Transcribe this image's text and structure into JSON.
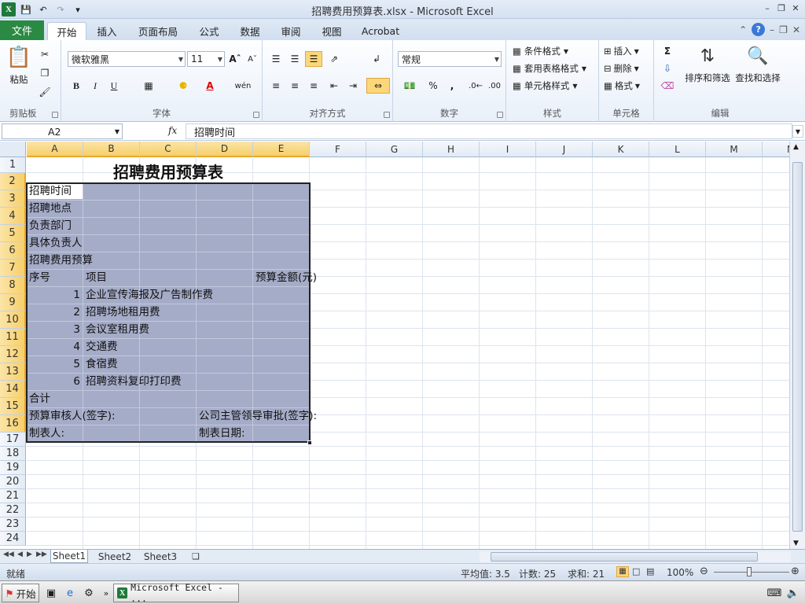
{
  "window": {
    "title": "招聘费用预算表.xlsx - Microsoft Excel"
  },
  "ribbon_tabs": [
    {
      "label": "文件"
    },
    {
      "label": "开始"
    },
    {
      "label": "插入"
    },
    {
      "label": "页面布局"
    },
    {
      "label": "公式"
    },
    {
      "label": "数据"
    },
    {
      "label": "审阅"
    },
    {
      "label": "视图"
    },
    {
      "label": "Acrobat"
    }
  ],
  "ribbon": {
    "clipboard": {
      "paste": "粘贴",
      "group": "剪贴板"
    },
    "font": {
      "name": "微软雅黑",
      "size": "11",
      "group": "字体",
      "bold": "B",
      "italic": "I",
      "underline": "U",
      "wen": "wén"
    },
    "alignment": {
      "group": "对齐方式"
    },
    "number": {
      "format": "常规",
      "group": "数字",
      "percent": "%",
      "comma": ","
    },
    "styles": {
      "conditional": "条件格式",
      "table": "套用表格格式",
      "cell": "单元格样式",
      "group": "样式"
    },
    "cells": {
      "insert": "插入",
      "delete": "删除",
      "format": "格式",
      "group": "单元格"
    },
    "editing": {
      "sort": "排序和筛选",
      "find": "查找和选择",
      "group": "编辑",
      "sum": "Σ"
    }
  },
  "formula_bar": {
    "name_box": "A2",
    "fx": "fx",
    "content": "招聘时间"
  },
  "columns": [
    "A",
    "B",
    "C",
    "D",
    "E",
    "F",
    "G",
    "H",
    "I",
    "J",
    "K",
    "L",
    "M",
    "N"
  ],
  "rows": [
    "1",
    "2",
    "3",
    "4",
    "5",
    "6",
    "7",
    "8",
    "9",
    "10",
    "11",
    "12",
    "13",
    "14",
    "15",
    "16",
    "17",
    "18",
    "19",
    "20",
    "21",
    "22",
    "23",
    "24"
  ],
  "sheet": {
    "title": "招聘费用预算表",
    "a2": "招聘时间",
    "a3": "招聘地点",
    "a4": "负责部门",
    "a5": "具体负责人",
    "a6": "招聘费用预算",
    "a7": "序号",
    "b7": "项目",
    "e7": "预算金额(元)",
    "items": [
      {
        "no": "1",
        "name": "企业宣传海报及广告制作费"
      },
      {
        "no": "2",
        "name": "招聘场地租用费"
      },
      {
        "no": "3",
        "name": "会议室租用费"
      },
      {
        "no": "4",
        "name": "交通费"
      },
      {
        "no": "5",
        "name": "食宿费"
      },
      {
        "no": "6",
        "name": "招聘资料复印打印费"
      }
    ],
    "a14": "合计",
    "a15": "预算审核人(签字):",
    "d15": "公司主管领导审批(签字):",
    "a16": "制表人:",
    "d16": "制表日期:"
  },
  "sheet_tabs": [
    {
      "label": "Sheet1"
    },
    {
      "label": "Sheet2"
    },
    {
      "label": "Sheet3"
    }
  ],
  "status": {
    "ready": "就绪",
    "average": "平均值: 3.5",
    "count": "计数: 25",
    "sum": "求和: 21",
    "zoom": "100%"
  },
  "taskbar": {
    "start": "开始",
    "task": "Microsoft Excel - ..."
  },
  "colors": {
    "accent": "#2a8a43",
    "selection_fill": "#a5acc8",
    "header_selected": "#f7cf6a"
  }
}
